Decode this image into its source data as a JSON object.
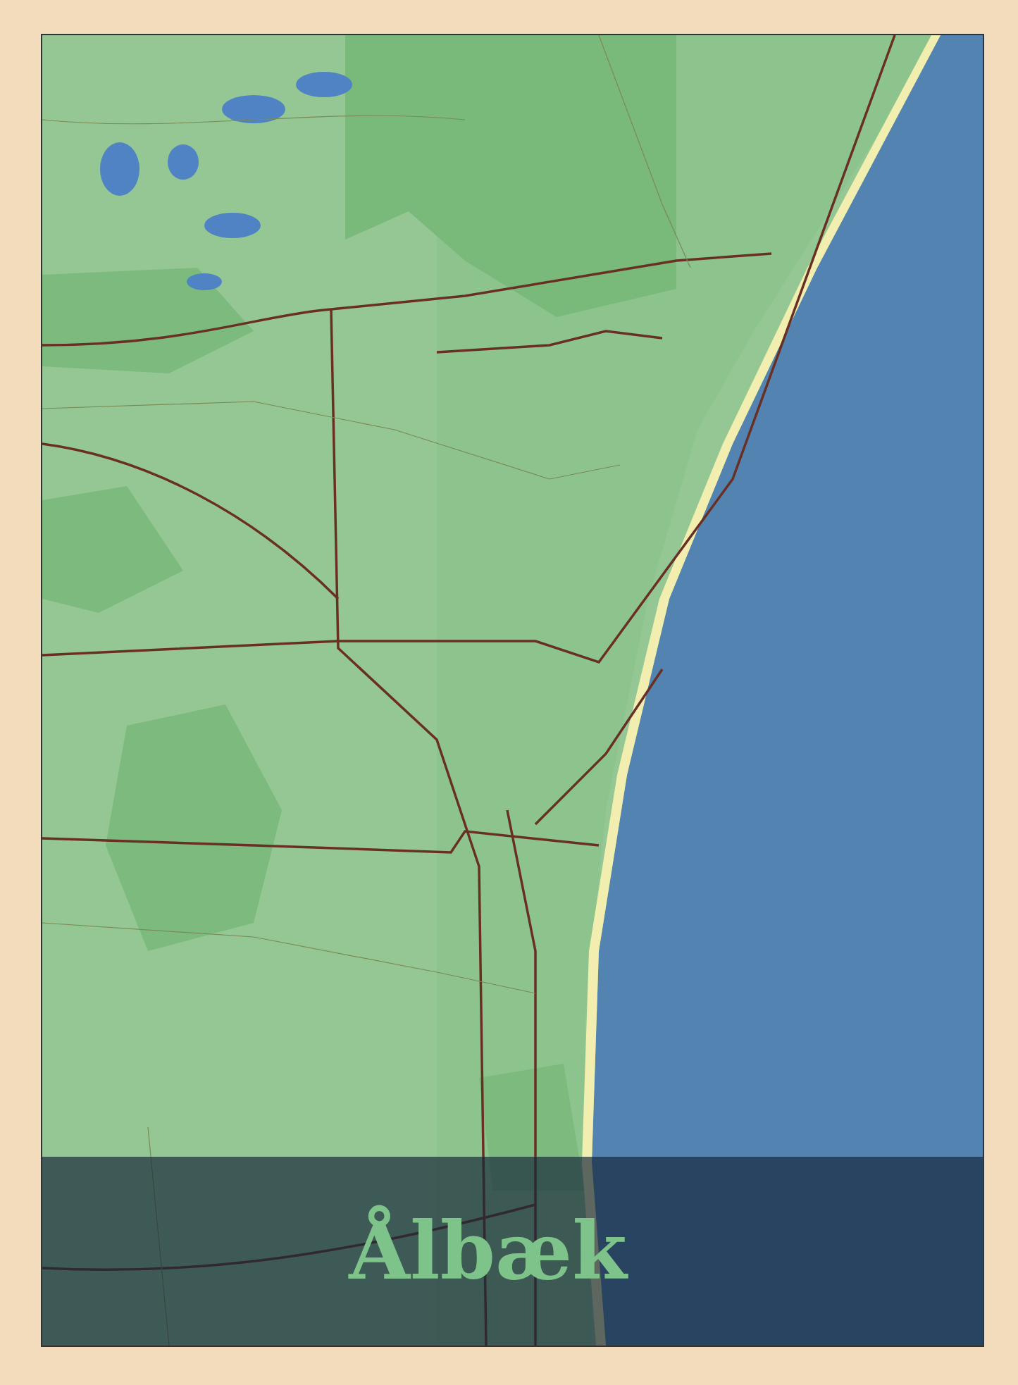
{
  "poster": {
    "title": "Ålbæk"
  }
}
